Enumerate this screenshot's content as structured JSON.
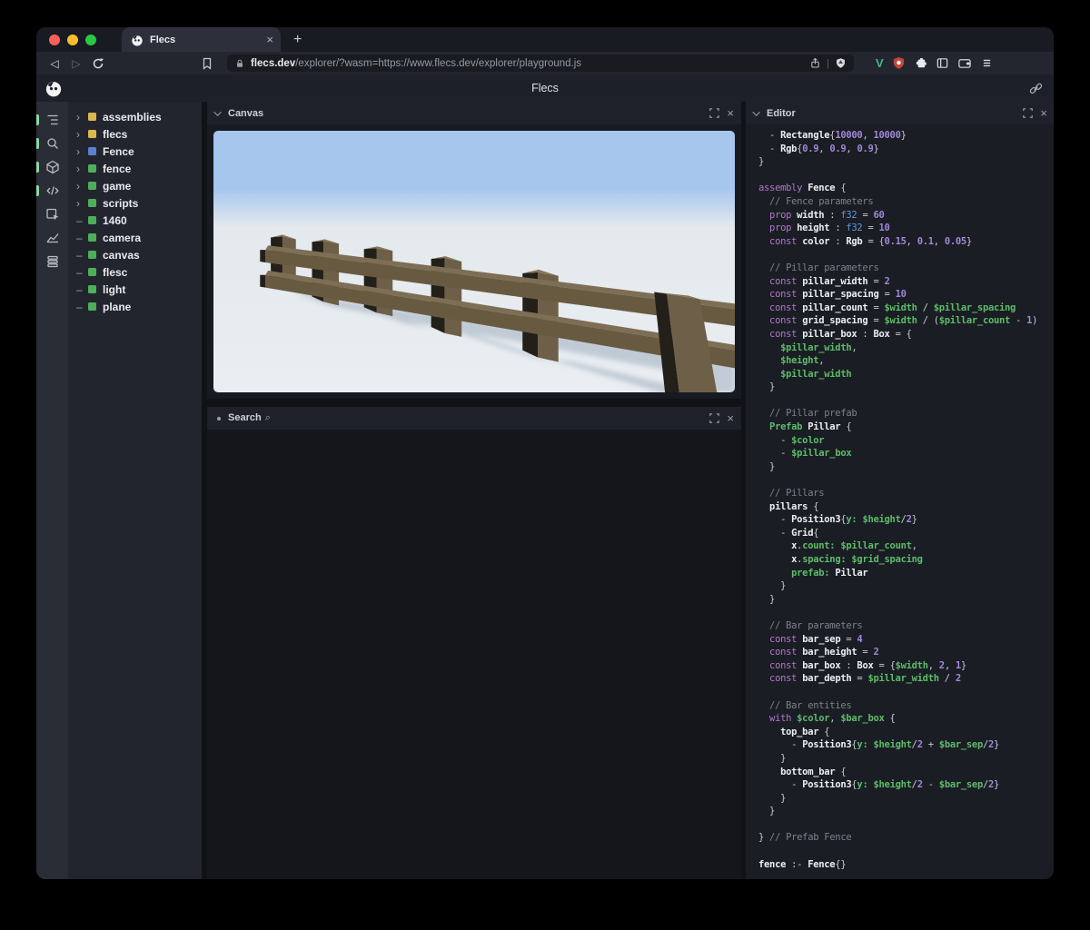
{
  "browser": {
    "tab_title": "Flecs",
    "new_tab_label": "+",
    "close_tab_label": "×",
    "url_domain": "flecs.dev",
    "url_path": "/explorer/?wasm=https://www.flecs.dev/explorer/playground.js",
    "extension_v_label": "V"
  },
  "app": {
    "title": "Flecs"
  },
  "panels": {
    "canvas": {
      "title": "Canvas"
    },
    "search": {
      "title": "Search",
      "mag": "⌕"
    },
    "editor": {
      "title": "Editor"
    },
    "close_glyph": "×"
  },
  "sidebar": {
    "icons": [
      {
        "name": "outliner",
        "active": true
      },
      {
        "name": "search",
        "active": true
      },
      {
        "name": "entities",
        "active": true
      },
      {
        "name": "script",
        "active": true
      },
      {
        "name": "inspector",
        "active": false
      },
      {
        "name": "statistics",
        "active": false
      },
      {
        "name": "queries",
        "active": false
      }
    ]
  },
  "tree": {
    "items": [
      {
        "label": "assemblies",
        "color": "#d9b94c",
        "marker": "chevron"
      },
      {
        "label": "flecs",
        "color": "#d9b94c",
        "marker": "chevron"
      },
      {
        "label": "Fence",
        "color": "#5b80cf",
        "marker": "chevron"
      },
      {
        "label": "fence",
        "color": "#4fae5c",
        "marker": "chevron"
      },
      {
        "label": "game",
        "color": "#4fae5c",
        "marker": "chevron"
      },
      {
        "label": "scripts",
        "color": "#4fae5c",
        "marker": "chevron"
      },
      {
        "label": "1460",
        "color": "#4fae5c",
        "marker": "dash"
      },
      {
        "label": "camera",
        "color": "#4fae5c",
        "marker": "dash"
      },
      {
        "label": "canvas",
        "color": "#4fae5c",
        "marker": "dash"
      },
      {
        "label": "flesc",
        "color": "#4fae5c",
        "marker": "dash"
      },
      {
        "label": "light",
        "color": "#4fae5c",
        "marker": "dash"
      },
      {
        "label": "plane",
        "color": "#4fae5c",
        "marker": "dash"
      }
    ]
  },
  "colors": {
    "sky": "#a6c6ee",
    "horizon": "#e4e9ed",
    "ground": "#eaeef2",
    "wood_front": "#6e5f48",
    "wood_side": "#23201a",
    "wood_top": "#867759",
    "rail_front": "#685a41",
    "rail_top": "#7d6e55",
    "shadow": "#8094aa",
    "accent_green": "#8fd6a2"
  },
  "editor": {
    "lines": [
      [
        [
          "p",
          "  - "
        ],
        [
          "i",
          "Rectangle"
        ],
        [
          "p",
          "{"
        ],
        [
          "n",
          "10000"
        ],
        [
          "p",
          ", "
        ],
        [
          "n",
          "10000"
        ],
        [
          "p",
          "}"
        ]
      ],
      [
        [
          "p",
          "  - "
        ],
        [
          "i",
          "Rgb"
        ],
        [
          "p",
          "{"
        ],
        [
          "n",
          "0.9"
        ],
        [
          "p",
          ", "
        ],
        [
          "n",
          "0.9"
        ],
        [
          "p",
          ", "
        ],
        [
          "n",
          "0.9"
        ],
        [
          "p",
          "}"
        ]
      ],
      [
        [
          "p",
          "}"
        ]
      ],
      [],
      [
        [
          "k",
          "assembly "
        ],
        [
          "i",
          "Fence"
        ],
        [
          "p",
          " {"
        ]
      ],
      [
        [
          "c",
          "  // Fence parameters"
        ]
      ],
      [
        [
          "p",
          "  "
        ],
        [
          "k",
          "prop "
        ],
        [
          "i",
          "width"
        ],
        [
          "p",
          " : "
        ],
        [
          "t",
          "f32"
        ],
        [
          "p",
          " = "
        ],
        [
          "n",
          "60"
        ]
      ],
      [
        [
          "p",
          "  "
        ],
        [
          "k",
          "prop "
        ],
        [
          "i",
          "height"
        ],
        [
          "p",
          " : "
        ],
        [
          "t",
          "f32"
        ],
        [
          "p",
          " = "
        ],
        [
          "n",
          "10"
        ]
      ],
      [
        [
          "p",
          "  "
        ],
        [
          "k",
          "const "
        ],
        [
          "i",
          "color"
        ],
        [
          "p",
          " : "
        ],
        [
          "i",
          "Rgb"
        ],
        [
          "p",
          " = {"
        ],
        [
          "n",
          "0.15"
        ],
        [
          "p",
          ", "
        ],
        [
          "n",
          "0.1"
        ],
        [
          "p",
          ", "
        ],
        [
          "n",
          "0.05"
        ],
        [
          "p",
          "}"
        ]
      ],
      [],
      [
        [
          "c",
          "  // Pillar parameters"
        ]
      ],
      [
        [
          "p",
          "  "
        ],
        [
          "k",
          "const "
        ],
        [
          "i",
          "pillar_width"
        ],
        [
          "p",
          " = "
        ],
        [
          "n",
          "2"
        ]
      ],
      [
        [
          "p",
          "  "
        ],
        [
          "k",
          "const "
        ],
        [
          "i",
          "pillar_spacing"
        ],
        [
          "p",
          " = "
        ],
        [
          "n",
          "10"
        ]
      ],
      [
        [
          "p",
          "  "
        ],
        [
          "k",
          "const "
        ],
        [
          "i",
          "pillar_count"
        ],
        [
          "p",
          " = "
        ],
        [
          "g",
          "$width"
        ],
        [
          "p",
          " / "
        ],
        [
          "g",
          "$pillar_spacing"
        ]
      ],
      [
        [
          "p",
          "  "
        ],
        [
          "k",
          "const "
        ],
        [
          "i",
          "grid_spacing"
        ],
        [
          "p",
          " = "
        ],
        [
          "g",
          "$width"
        ],
        [
          "p",
          " / ("
        ],
        [
          "g",
          "$pillar_count"
        ],
        [
          "p",
          " - "
        ],
        [
          "n",
          "1"
        ],
        [
          "p",
          ")"
        ]
      ],
      [
        [
          "p",
          "  "
        ],
        [
          "k",
          "const "
        ],
        [
          "i",
          "pillar_box"
        ],
        [
          "p",
          " : "
        ],
        [
          "i",
          "Box"
        ],
        [
          "p",
          " = {"
        ]
      ],
      [
        [
          "g",
          "    $pillar_width"
        ],
        [
          "p",
          ","
        ]
      ],
      [
        [
          "g",
          "    $height"
        ],
        [
          "p",
          ","
        ]
      ],
      [
        [
          "g",
          "    $pillar_width"
        ]
      ],
      [
        [
          "p",
          "  }"
        ]
      ],
      [],
      [
        [
          "c",
          "  // Pillar prefab"
        ]
      ],
      [
        [
          "p",
          "  "
        ],
        [
          "g",
          "Prefab "
        ],
        [
          "i",
          "Pillar"
        ],
        [
          "p",
          " {"
        ]
      ],
      [
        [
          "p",
          "    - "
        ],
        [
          "g",
          "$color"
        ]
      ],
      [
        [
          "p",
          "    - "
        ],
        [
          "g",
          "$pillar_box"
        ]
      ],
      [
        [
          "p",
          "  }"
        ]
      ],
      [],
      [
        [
          "c",
          "  // Pillars"
        ]
      ],
      [
        [
          "p",
          "  "
        ],
        [
          "i",
          "pillars"
        ],
        [
          "p",
          " {"
        ]
      ],
      [
        [
          "p",
          "    - "
        ],
        [
          "i",
          "Position3"
        ],
        [
          "p",
          "{"
        ],
        [
          "g",
          "y: "
        ],
        [
          "g",
          "$height"
        ],
        [
          "p",
          "/"
        ],
        [
          "n",
          "2"
        ],
        [
          "p",
          "}"
        ]
      ],
      [
        [
          "p",
          "    - "
        ],
        [
          "i",
          "Grid"
        ],
        [
          "p",
          "{"
        ]
      ],
      [
        [
          "p",
          "      "
        ],
        [
          "i",
          "x"
        ],
        [
          "p",
          "."
        ],
        [
          "g",
          "count: "
        ],
        [
          "g",
          "$pillar_count"
        ],
        [
          "p",
          ","
        ]
      ],
      [
        [
          "p",
          "      "
        ],
        [
          "i",
          "x"
        ],
        [
          "p",
          "."
        ],
        [
          "g",
          "spacing: "
        ],
        [
          "g",
          "$grid_spacing"
        ]
      ],
      [
        [
          "p",
          "      "
        ],
        [
          "g",
          "prefab: "
        ],
        [
          "i",
          "Pillar"
        ]
      ],
      [
        [
          "p",
          "    }"
        ]
      ],
      [
        [
          "p",
          "  }"
        ]
      ],
      [],
      [
        [
          "c",
          "  // Bar parameters"
        ]
      ],
      [
        [
          "p",
          "  "
        ],
        [
          "k",
          "const "
        ],
        [
          "i",
          "bar_sep"
        ],
        [
          "p",
          " = "
        ],
        [
          "n",
          "4"
        ]
      ],
      [
        [
          "p",
          "  "
        ],
        [
          "k",
          "const "
        ],
        [
          "i",
          "bar_height"
        ],
        [
          "p",
          " = "
        ],
        [
          "n",
          "2"
        ]
      ],
      [
        [
          "p",
          "  "
        ],
        [
          "k",
          "const "
        ],
        [
          "i",
          "bar_box"
        ],
        [
          "p",
          " : "
        ],
        [
          "i",
          "Box"
        ],
        [
          "p",
          " = {"
        ],
        [
          "g",
          "$width"
        ],
        [
          "p",
          ", "
        ],
        [
          "n",
          "2"
        ],
        [
          "p",
          ", "
        ],
        [
          "n",
          "1"
        ],
        [
          "p",
          "}"
        ]
      ],
      [
        [
          "p",
          "  "
        ],
        [
          "k",
          "const "
        ],
        [
          "i",
          "bar_depth"
        ],
        [
          "p",
          " = "
        ],
        [
          "g",
          "$pillar_width"
        ],
        [
          "p",
          " / "
        ],
        [
          "n",
          "2"
        ]
      ],
      [],
      [
        [
          "c",
          "  // Bar entities"
        ]
      ],
      [
        [
          "p",
          "  "
        ],
        [
          "k",
          "with "
        ],
        [
          "g",
          "$color"
        ],
        [
          "p",
          ", "
        ],
        [
          "g",
          "$bar_box"
        ],
        [
          "p",
          " {"
        ]
      ],
      [
        [
          "p",
          "    "
        ],
        [
          "i",
          "top_bar"
        ],
        [
          "p",
          " {"
        ]
      ],
      [
        [
          "p",
          "      - "
        ],
        [
          "i",
          "Position3"
        ],
        [
          "p",
          "{"
        ],
        [
          "g",
          "y: "
        ],
        [
          "g",
          "$height"
        ],
        [
          "p",
          "/"
        ],
        [
          "n",
          "2"
        ],
        [
          "p",
          " + "
        ],
        [
          "g",
          "$bar_sep"
        ],
        [
          "p",
          "/"
        ],
        [
          "n",
          "2"
        ],
        [
          "p",
          "}"
        ]
      ],
      [
        [
          "p",
          "    }"
        ]
      ],
      [
        [
          "p",
          "    "
        ],
        [
          "i",
          "bottom_bar"
        ],
        [
          "p",
          " {"
        ]
      ],
      [
        [
          "p",
          "      - "
        ],
        [
          "i",
          "Position3"
        ],
        [
          "p",
          "{"
        ],
        [
          "g",
          "y: "
        ],
        [
          "g",
          "$height"
        ],
        [
          "p",
          "/"
        ],
        [
          "n",
          "2"
        ],
        [
          "p",
          " - "
        ],
        [
          "g",
          "$bar_sep"
        ],
        [
          "p",
          "/"
        ],
        [
          "n",
          "2"
        ],
        [
          "p",
          "}"
        ]
      ],
      [
        [
          "p",
          "    }"
        ]
      ],
      [
        [
          "p",
          "  }"
        ]
      ],
      [],
      [
        [
          "p",
          "} "
        ],
        [
          "c",
          "// Prefab Fence"
        ]
      ],
      [],
      [
        [
          "i",
          "fence"
        ],
        [
          "p",
          " :- "
        ],
        [
          "i",
          "Fence"
        ],
        [
          "p",
          "{}"
        ]
      ]
    ]
  }
}
